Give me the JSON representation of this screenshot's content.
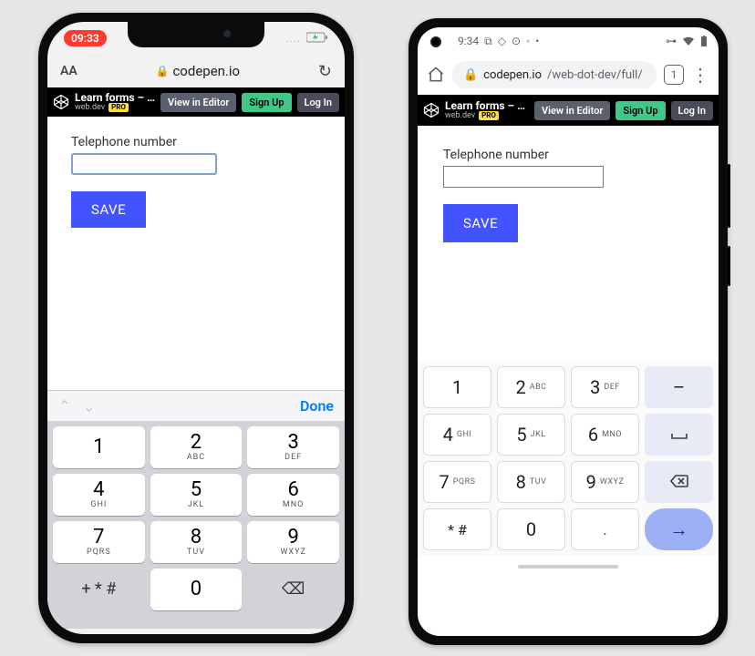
{
  "ios": {
    "status": {
      "time": "09:33",
      "signal": "....",
      "battery_state": "charging"
    },
    "browser": {
      "aA": "AA",
      "host": "codepen.io"
    },
    "codepen": {
      "title": "Learn forms – virt…",
      "author": "web.dev",
      "badge": "PRO",
      "view": "View in Editor",
      "signup": "Sign Up",
      "login": "Log In"
    },
    "form": {
      "label": "Telephone number",
      "value": "",
      "save": "SAVE"
    },
    "accessory": {
      "done": "Done"
    },
    "keypad": [
      {
        "n": "1",
        "l": ""
      },
      {
        "n": "2",
        "l": "ABC"
      },
      {
        "n": "3",
        "l": "DEF"
      },
      {
        "n": "4",
        "l": "GHI"
      },
      {
        "n": "5",
        "l": "JKL"
      },
      {
        "n": "6",
        "l": "MNO"
      },
      {
        "n": "7",
        "l": "PQRS"
      },
      {
        "n": "8",
        "l": "TUV"
      },
      {
        "n": "9",
        "l": "WXYZ"
      },
      {
        "n": "+ * #",
        "l": "",
        "flat": true
      },
      {
        "n": "0",
        "l": ""
      },
      {
        "n": "⌫",
        "l": "",
        "flat": true
      }
    ]
  },
  "android": {
    "status": {
      "time": "9:34"
    },
    "browser": {
      "host": "codepen.io",
      "path": "/web-dot-dev/full/",
      "tab_count": "1"
    },
    "codepen": {
      "title": "Learn forms – virt…",
      "author": "web.dev",
      "badge": "PRO",
      "view": "View in Editor",
      "signup": "Sign Up",
      "login": "Log In"
    },
    "form": {
      "label": "Telephone number",
      "value": "",
      "save": "SAVE"
    },
    "keypad": [
      {
        "n": "1",
        "l": ""
      },
      {
        "n": "2",
        "l": "ABC"
      },
      {
        "n": "3",
        "l": "DEF"
      },
      {
        "n": "–",
        "l": "",
        "side": true
      },
      {
        "n": "4",
        "l": "GHI"
      },
      {
        "n": "5",
        "l": "JKL"
      },
      {
        "n": "6",
        "l": "MNO"
      },
      {
        "n": "␣",
        "l": "",
        "side": true
      },
      {
        "n": "7",
        "l": "PQRS"
      },
      {
        "n": "8",
        "l": "TUV"
      },
      {
        "n": "9",
        "l": "WXYZ"
      },
      {
        "n": "⌫",
        "l": "",
        "side": true
      },
      {
        "n": "* #",
        "l": "",
        "sym": true
      },
      {
        "n": "0",
        "l": ""
      },
      {
        "n": ".",
        "l": "",
        "sym": true
      },
      {
        "n": "→",
        "l": "",
        "enter": true
      }
    ]
  }
}
